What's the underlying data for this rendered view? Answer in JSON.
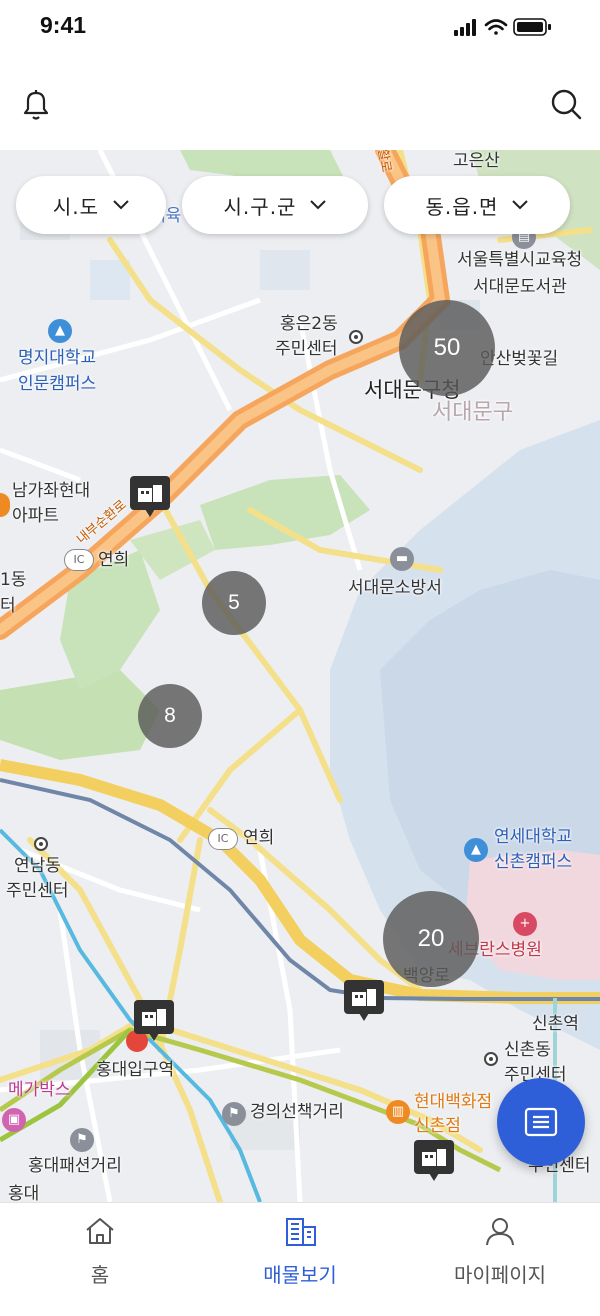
{
  "status_bar": {
    "time": "9:41"
  },
  "header": {
    "bell_icon": "bell-icon",
    "search_icon": "search-icon"
  },
  "filters": [
    {
      "label": "시.도"
    },
    {
      "label": "시.구.군"
    },
    {
      "label": "동.읍.면"
    }
  ],
  "map": {
    "labels": {
      "goeunsan": "고은산",
      "edu_office": "서울특별시교육청",
      "library": "서대문도서관",
      "hongeun_center_1": "홍은2동",
      "hongeun_center_2": "주민센터",
      "ansan": "안산벚꽃길",
      "myongji_1": "명지대학교",
      "myongji_2": "인문캠퍼스",
      "gu_office": "서대문구청",
      "district": "서대문구",
      "namgajwa_1": "남가좌현대",
      "namgajwa_2": "아파트",
      "ic_yeonhui_top": "연희",
      "fire_station": "서대문소방서",
      "yeonhui_ic": "연희",
      "yeonnam_1": "연남동",
      "yeonnam_2": "주민센터",
      "yonsei_1": "연세대학교",
      "yonsei_2": "신촌캠퍼스",
      "severance": "세브란스병원",
      "baekyang": "백양로",
      "sinchon_station": "신촌역",
      "sinchon_center_1": "신촌동",
      "sinchon_center_2": "주민센터",
      "hongik_station": "홍대입구역",
      "megabox": "메가박스",
      "gyeongui": "경의선책거리",
      "hyundai_1": "현대백화점",
      "hyundai_2": "신촌점",
      "fashion": "홍대패션거리",
      "hongdae": "홍대",
      "yeonhui_center_2": "주민센터",
      "edge_1": "1동",
      "edge_2": "터",
      "road_name": "내부순환로",
      "edge_top": "체육",
      "hwal": "활로",
      "ic_badge": "IC"
    },
    "clusters": [
      {
        "count": "50"
      },
      {
        "count": "5"
      },
      {
        "count": "8"
      },
      {
        "count": "20"
      }
    ],
    "markers": [
      "building-marker-icon",
      "building-marker-icon",
      "building-marker-icon",
      "building-marker-icon"
    ]
  },
  "fab": {
    "icon": "list-icon"
  },
  "tabbar": {
    "tabs": [
      {
        "label": "홈",
        "icon": "home-icon",
        "active": false
      },
      {
        "label": "매물보기",
        "icon": "buildings-icon",
        "active": true
      },
      {
        "label": "마이페이지",
        "icon": "person-icon",
        "active": false
      }
    ]
  },
  "colors": {
    "accent": "#2f5fd8",
    "cluster": "#5a5a5a",
    "park": "#c8e2b9",
    "water": "#cfdcec",
    "highway": "#f6a65c"
  }
}
